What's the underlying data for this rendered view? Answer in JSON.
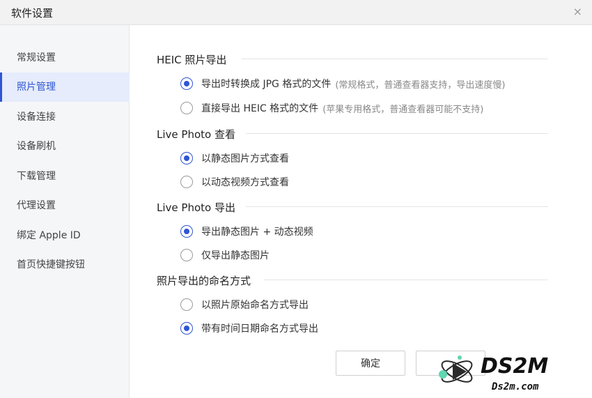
{
  "window": {
    "title": "软件设置",
    "close_icon": "×"
  },
  "sidebar": {
    "items": [
      {
        "label": "常规设置",
        "active": false
      },
      {
        "label": "照片管理",
        "active": true
      },
      {
        "label": "设备连接",
        "active": false
      },
      {
        "label": "设备刷机",
        "active": false
      },
      {
        "label": "下载管理",
        "active": false
      },
      {
        "label": "代理设置",
        "active": false
      },
      {
        "label": "绑定 Apple ID",
        "active": false
      },
      {
        "label": "首页快捷键按钮",
        "active": false
      }
    ]
  },
  "sections": [
    {
      "title": "HEIC 照片导出",
      "options": [
        {
          "label": "导出时转换成 JPG 格式的文件",
          "hint": "(常规格式，普通查看器支持，导出速度慢)",
          "checked": true
        },
        {
          "label": "直接导出 HEIC 格式的文件",
          "hint": "(苹果专用格式，普通查看器可能不支持)",
          "checked": false
        }
      ]
    },
    {
      "title": "Live Photo 查看",
      "options": [
        {
          "label": "以静态图片方式查看",
          "checked": true
        },
        {
          "label": "以动态视频方式查看",
          "checked": false
        }
      ]
    },
    {
      "title": "Live Photo 导出",
      "options": [
        {
          "label": "导出静态图片 + 动态视频",
          "checked": true
        },
        {
          "label": "仅导出静态图片",
          "checked": false
        }
      ]
    },
    {
      "title": "照片导出的命名方式",
      "options": [
        {
          "label": "以照片原始命名方式导出",
          "checked": false
        },
        {
          "label": "带有时间日期命名方式导出",
          "checked": true
        }
      ]
    }
  ],
  "buttons": {
    "confirm": "确定",
    "cancel": ""
  },
  "watermark": {
    "name": "DS2M",
    "domain": "Ds2m.com"
  },
  "colors": {
    "accent": "#2f55d4",
    "sidebar_bg": "#f5f6f8",
    "active_bg": "#e6ecfb"
  }
}
